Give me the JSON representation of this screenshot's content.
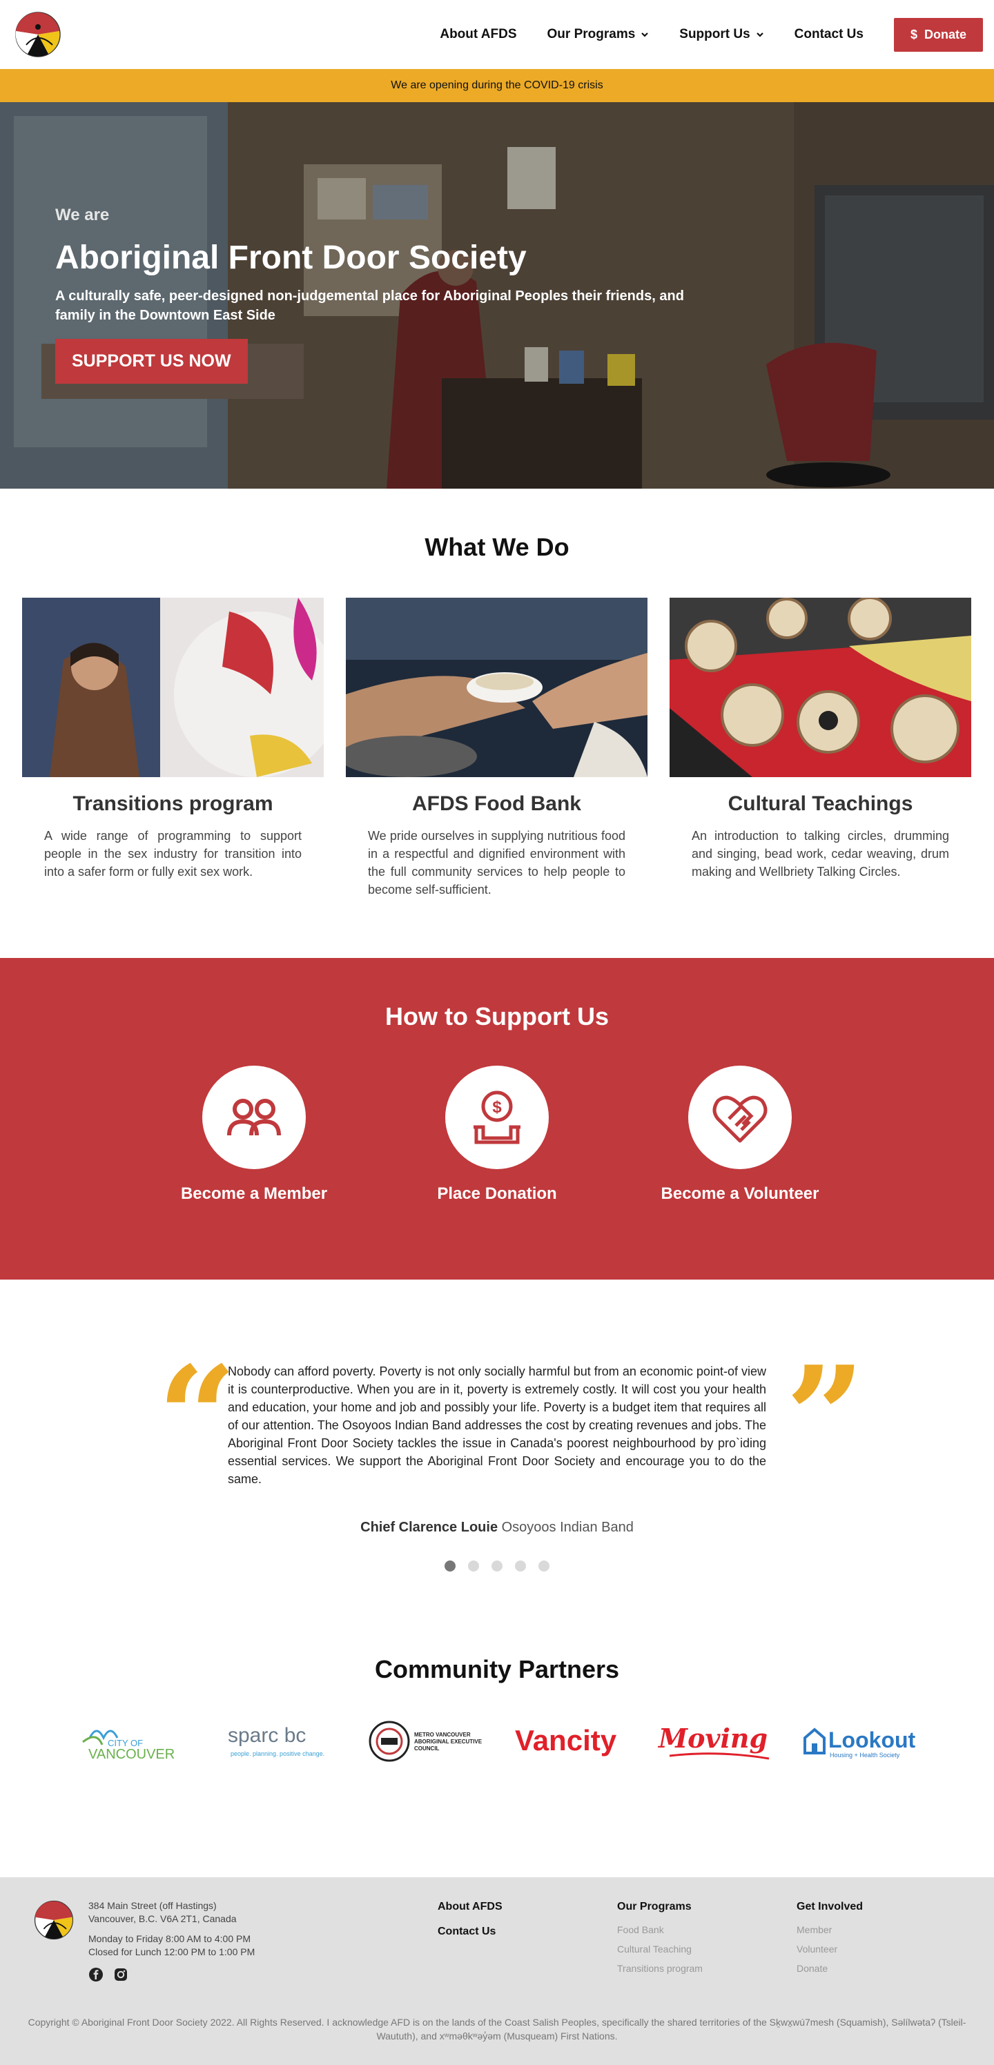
{
  "header": {
    "nav": [
      {
        "label": "About AFDS",
        "dropdown": false
      },
      {
        "label": "Our Programs",
        "dropdown": true
      },
      {
        "label": "Support Us",
        "dropdown": true
      },
      {
        "label": "Contact Us",
        "dropdown": false
      }
    ],
    "donate_label": "Donate",
    "donate_icon": "$"
  },
  "banner": {
    "text": "We are opening during the COVID-19 crisis"
  },
  "hero": {
    "kicker": "We are",
    "title": "Aboriginal Front Door Society",
    "subtitle": "A culturally safe, peer-designed non-judgemental place for Aboriginal Peoples their friends, and family in the Downtown East Side",
    "cta": "SUPPORT US NOW"
  },
  "what_we_do": {
    "title": "What We Do",
    "cards": [
      {
        "title": "Transitions program",
        "text": "A wide range of programming to support people in the sex industry for transition into into a safer form or fully exit sex work."
      },
      {
        "title": "AFDS Food Bank",
        "text": "We pride ourselves in supplying nutritious food in a respectful and dignified environment with the full community services to help people to become self-sufficient."
      },
      {
        "title": "Cultural Teachings",
        "text": "An introduction to talking circles, drumming and singing, bead work, cedar weaving, drum making and Wellbriety Talking Circles."
      }
    ]
  },
  "support": {
    "title": "How to Support Us",
    "items": [
      {
        "label": "Become a Member",
        "icon": "members-icon"
      },
      {
        "label": "Place Donation",
        "icon": "donation-icon"
      },
      {
        "label": "Become a Volunteer",
        "icon": "heart-hands-icon"
      }
    ]
  },
  "testimonial": {
    "quote": "Nobody can afford poverty. Poverty is not only socially harmful but from an economic point-of view it is counterproductive. When you are in it, poverty is extremely costly. It will cost you your health and education, your home and job and possibly your life. Poverty is a budget item that requires all of our attention. The Osoyoos Indian Band addresses the cost by creating revenues and jobs. The Aboriginal Front Door Society tackles the issue in Canada's poorest neighbourhood by pro`iding essential services. We support the Aboriginal Front Door Society and encourage you to do the same.",
    "author": "Chief Clarence Louie",
    "affiliation": "Osoyoos Indian Band",
    "open_mark": "“",
    "close_mark": "”",
    "slide_count": 5,
    "active_slide": 1
  },
  "partners": {
    "title": "Community Partners",
    "logos": [
      {
        "name": "city-of-vancouver-logo",
        "line1": "CITY OF",
        "line2": "VANCOUVER"
      },
      {
        "name": "sparc-bc-logo",
        "line1": "sparc bc",
        "line2": "people. planning. positive change."
      },
      {
        "name": "mvaec-logo",
        "line1": "METRO VANCOUVER",
        "line2": "ABORIGINAL EXECUTIVE",
        "line3": "COUNCIL"
      },
      {
        "name": "vancity-logo",
        "line1": "Vancity"
      },
      {
        "name": "moving-logo",
        "line1": "Moving"
      },
      {
        "name": "lookout-logo",
        "line1": "Lookout",
        "line2": "Housing + Health Society"
      }
    ]
  },
  "footer": {
    "address1": "384 Main Street (off Hastings)",
    "address2": "Vancouver, B.C. V6A 2T1, Canada",
    "hours1": "Monday to Friday 8:00 AM to 4:00 PM",
    "hours2": "Closed for Lunch 12:00 PM to 1:00 PM",
    "col1": [
      "About AFDS",
      "Contact Us"
    ],
    "col2": {
      "title": "Our Programs",
      "links": [
        "Food Bank",
        "Cultural Teaching",
        "Transitions program"
      ]
    },
    "col3": {
      "title": "Get Involved",
      "links": [
        "Member",
        "Volunteer",
        "Donate"
      ]
    },
    "copyright": "Copyright © Aboriginal Front Door Society 2022. All Rights Reserved. I acknowledge AFD is on the lands of the Coast Salish Peoples, specifically the shared territories of the Sḵwx̱wú7mesh (Squamish), Səlílwətaʔ (Tsleil-Waututh), and xʷməθkʷəy̓əm (Musqueam) First Nations."
  },
  "colors": {
    "brand_red": "#c0393c",
    "accent_yellow": "#ecaa27",
    "footer_bg": "#e0e0e0"
  }
}
